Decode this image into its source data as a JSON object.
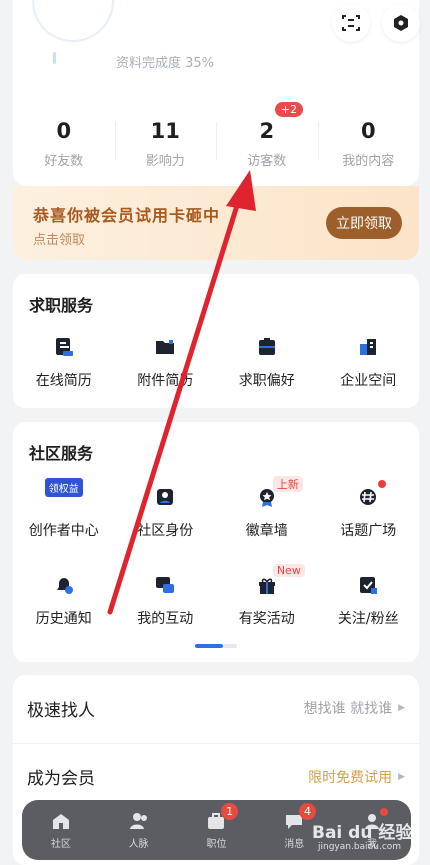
{
  "header": {
    "scan_icon": "scan-icon",
    "settings_icon": "hexagon-settings-icon"
  },
  "profile": {
    "completion_text": "资料完成度 35%",
    "stats": [
      {
        "value": "0",
        "label": "好友数"
      },
      {
        "value": "11",
        "label": "影响力"
      },
      {
        "value": "2",
        "label": "访客数",
        "badge": "+2"
      },
      {
        "value": "0",
        "label": "我的内容"
      }
    ]
  },
  "vip_banner": {
    "title": "恭喜你被会员试用卡砸中",
    "subtitle": "点击领取",
    "button": "立即领取"
  },
  "job_services": {
    "title": "求职服务",
    "items": [
      {
        "label": "在线简历",
        "icon": "resume-icon"
      },
      {
        "label": "附件简历",
        "icon": "folder-icon"
      },
      {
        "label": "求职偏好",
        "icon": "preference-icon"
      },
      {
        "label": "企业空间",
        "icon": "building-icon"
      }
    ]
  },
  "community_services": {
    "title": "社区服务",
    "items": [
      {
        "label": "创作者中心",
        "icon": "creator-icon",
        "tag": "领权益"
      },
      {
        "label": "社区身份",
        "icon": "identity-icon"
      },
      {
        "label": "徽章墙",
        "icon": "badge-icon",
        "tag": "上新"
      },
      {
        "label": "话题广场",
        "icon": "topic-icon",
        "dot": true
      },
      {
        "label": "历史通知",
        "icon": "notice-history-icon"
      },
      {
        "label": "我的互动",
        "icon": "interaction-icon"
      },
      {
        "label": "有奖活动",
        "icon": "gift-icon",
        "tag": "New"
      },
      {
        "label": "关注/粉丝",
        "icon": "follow-icon"
      }
    ]
  },
  "list": [
    {
      "title": "极速找人",
      "aside": "想找谁 就找谁"
    },
    {
      "title": "成为会员",
      "aside": "限时免费试用"
    }
  ],
  "tabbar": [
    {
      "label": "社区",
      "icon": "home-icon"
    },
    {
      "label": "人脉",
      "icon": "contacts-icon"
    },
    {
      "label": "职位",
      "icon": "briefcase-icon",
      "badge": "1"
    },
    {
      "label": "消息",
      "icon": "message-icon",
      "badge": "4"
    },
    {
      "label": "我",
      "icon": "profile-icon",
      "dot": true
    }
  ],
  "watermark": {
    "text": "Bai du 经验",
    "sub": "jingyan.baidu.com"
  },
  "colors": {
    "accent": "#2f6fe4",
    "vip_brown": "#9c5f2c",
    "badge_red": "#e9493f",
    "annotation_arrow": "#e0242f"
  }
}
